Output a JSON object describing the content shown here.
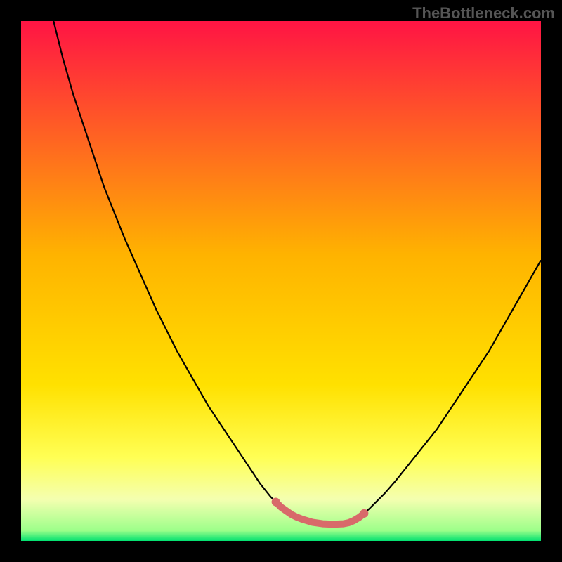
{
  "watermark": "TheBottleneck.com",
  "colors": {
    "frame": "#000000",
    "curve": "#000000",
    "salmon": "#d86a6a",
    "top": "#ff1444",
    "mid": "#ffd400",
    "yellow": "#ffff55",
    "pale": "#f4ffb0",
    "green": "#00e070"
  },
  "chart_data": {
    "type": "line",
    "title": "",
    "xlabel": "",
    "ylabel": "",
    "xlim": [
      0,
      100
    ],
    "ylim": [
      0,
      100
    ],
    "x": [
      0,
      2,
      4,
      6,
      8,
      10,
      12,
      14,
      15,
      16,
      18,
      20,
      22,
      24,
      26,
      28,
      30,
      32,
      34,
      36,
      38,
      40,
      42,
      44,
      46,
      48,
      49,
      50,
      51,
      52,
      53,
      54,
      56,
      58,
      60,
      62,
      63,
      64,
      65,
      66,
      67,
      68,
      70,
      72,
      74,
      76,
      78,
      80,
      82,
      84,
      86,
      88,
      90,
      92,
      94,
      96,
      98,
      100
    ],
    "values": [
      125,
      117,
      109,
      101,
      93,
      86,
      80,
      74,
      71,
      68,
      63,
      58,
      53.5,
      49,
      44.5,
      40.5,
      36.5,
      33,
      29.5,
      26,
      23,
      20,
      17,
      14,
      11,
      8.5,
      7.5,
      6.5,
      5.8,
      5.1,
      4.6,
      4.2,
      3.6,
      3.3,
      3.2,
      3.3,
      3.5,
      3.9,
      4.5,
      5.3,
      6.2,
      7.2,
      9.2,
      11.5,
      14,
      16.5,
      19,
      21.5,
      24.5,
      27.5,
      30.5,
      33.5,
      36.5,
      40,
      43.5,
      47,
      50.5,
      54
    ],
    "bottom_segment": {
      "x_range": [
        49,
        66
      ],
      "y_range": [
        3.2,
        7.5
      ]
    }
  }
}
